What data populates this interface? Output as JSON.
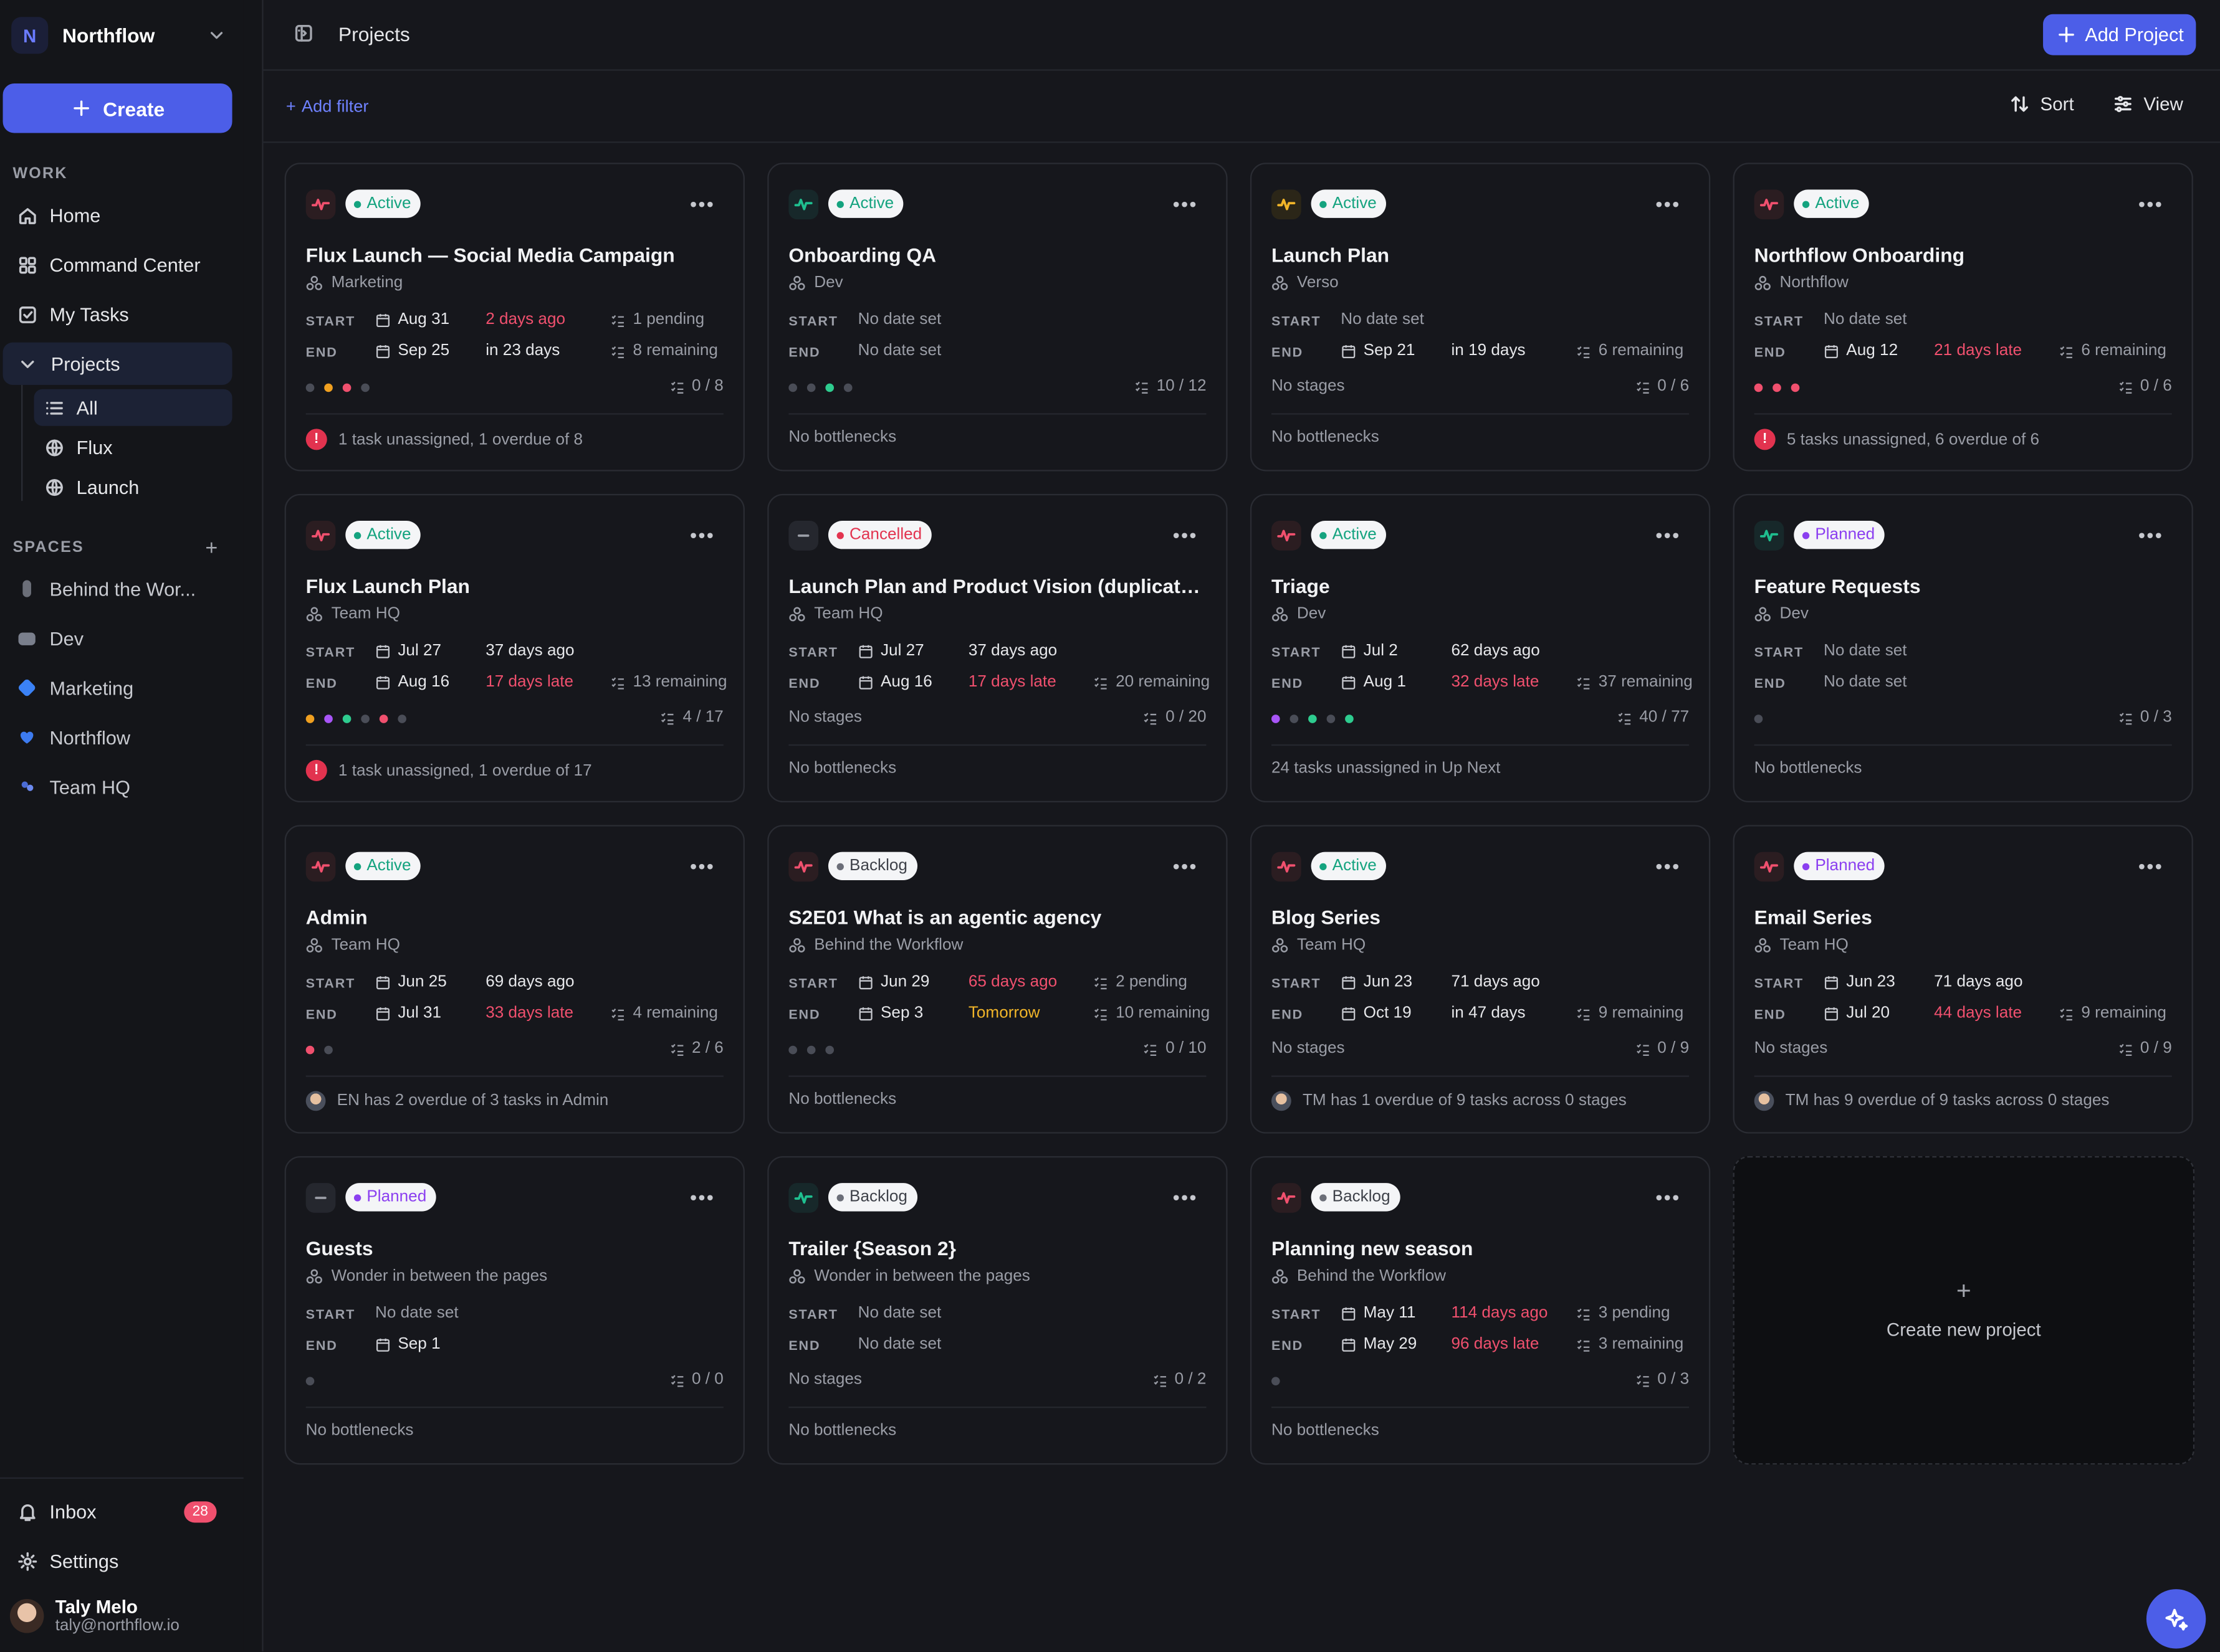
{
  "workspace": {
    "initial": "N",
    "name": "Northflow"
  },
  "sidebar": {
    "create_label": "Create",
    "work_label": "WORK",
    "items": [
      {
        "label": "Home"
      },
      {
        "label": "Command Center"
      },
      {
        "label": "My Tasks"
      },
      {
        "label": "Projects"
      }
    ],
    "project_views": [
      {
        "label": "All"
      },
      {
        "label": "Flux"
      },
      {
        "label": "Launch"
      }
    ],
    "spaces_label": "SPACES",
    "spaces": [
      {
        "label": "Behind the Wor...",
        "color": "#6b6e78"
      },
      {
        "label": "Dev",
        "color": "#7a7f8c"
      },
      {
        "label": "Marketing",
        "color": "#3b82f6"
      },
      {
        "label": "Northflow",
        "color": "#3d7bf0"
      },
      {
        "label": "Team HQ",
        "color": "#4b6cd6"
      }
    ],
    "inbox_label": "Inbox",
    "inbox_count": "28",
    "settings_label": "Settings",
    "user": {
      "name": "Taly Melo",
      "email": "taly@northflow.io"
    }
  },
  "header": {
    "title": "Projects",
    "add_project_label": "Add Project"
  },
  "toolbar": {
    "add_filter": "Add filter",
    "sort": "Sort",
    "view": "View"
  },
  "labels": {
    "start": "START",
    "end": "END",
    "no_date": "No date set",
    "no_stages": "No stages"
  },
  "create_new_label": "Create new project",
  "projects": [
    {
      "title": "Flux Launch — Social Media Campaign",
      "status": "Active",
      "space": "Marketing",
      "start": "Aug 31",
      "start_rel": "2 days ago",
      "start_meta": "1 pending",
      "end": "Sep 25",
      "end_rel": "in 23 days",
      "end_meta": "8 remaining",
      "progress": "0 / 8",
      "footer": "1 task unassigned, 1 overdue of 8"
    },
    {
      "title": "Onboarding QA",
      "status": "Active",
      "space": "Dev",
      "start": "",
      "start_rel": "",
      "start_meta": "",
      "end": "",
      "end_rel": "",
      "end_meta": "",
      "progress": "10 / 12",
      "footer": "No bottlenecks"
    },
    {
      "title": "Launch Plan",
      "status": "Active",
      "space": "Verso",
      "start": "",
      "start_rel": "",
      "start_meta": "",
      "end": "Sep 21",
      "end_rel": "in 19 days",
      "end_meta": "6 remaining",
      "progress": "0 / 6",
      "footer": "No bottlenecks"
    },
    {
      "title": "Northflow Onboarding",
      "status": "Active",
      "space": "Northflow",
      "start": "",
      "start_rel": "",
      "start_meta": "",
      "end": "Aug 12",
      "end_rel": "21 days late",
      "end_meta": "6 remaining",
      "progress": "0 / 6",
      "footer": "5 tasks unassigned, 6 overdue of 6"
    },
    {
      "title": "Flux Launch Plan",
      "status": "Active",
      "space": "Team HQ",
      "start": "Jul 27",
      "start_rel": "37 days ago",
      "start_meta": "",
      "end": "Aug 16",
      "end_rel": "17 days late",
      "end_meta": "13 remaining",
      "progress": "4 / 17",
      "footer": "1 task unassigned, 1 overdue of 17"
    },
    {
      "title": "Launch Plan and Product Vision (duplicate, ...",
      "status": "Cancelled",
      "space": "Team HQ",
      "start": "Jul 27",
      "start_rel": "37 days ago",
      "start_meta": "",
      "end": "Aug 16",
      "end_rel": "17 days late",
      "end_meta": "20 remaining",
      "progress": "0 / 20",
      "footer": "No bottlenecks"
    },
    {
      "title": "Triage",
      "status": "Active",
      "space": "Dev",
      "start": "Jul 2",
      "start_rel": "62 days ago",
      "start_meta": "",
      "end": "Aug 1",
      "end_rel": "32 days late",
      "end_meta": "37 remaining",
      "progress": "40 / 77",
      "footer": "24 tasks unassigned in Up Next"
    },
    {
      "title": "Feature Requests",
      "status": "Planned",
      "space": "Dev",
      "start": "",
      "start_rel": "",
      "start_meta": "",
      "end": "",
      "end_rel": "",
      "end_meta": "",
      "progress": "0 / 3",
      "footer": "No bottlenecks"
    },
    {
      "title": "Admin",
      "status": "Active",
      "space": "Team HQ",
      "start": "Jun 25",
      "start_rel": "69 days ago",
      "start_meta": "",
      "end": "Jul 31",
      "end_rel": "33 days late",
      "end_meta": "4 remaining",
      "progress": "2 / 6",
      "footer": "EN has 2 overdue of 3 tasks in Admin"
    },
    {
      "title": "S2E01 What is an agentic agency",
      "status": "Backlog",
      "space": "Behind the Workflow",
      "start": "Jun 29",
      "start_rel": "65 days ago",
      "start_meta": "2 pending",
      "end": "Sep 3",
      "end_rel": "Tomorrow",
      "end_meta": "10 remaining",
      "progress": "0 / 10",
      "footer": "No bottlenecks"
    },
    {
      "title": "Blog Series",
      "status": "Active",
      "space": "Team HQ",
      "start": "Jun 23",
      "start_rel": "71 days ago",
      "start_meta": "",
      "end": "Oct 19",
      "end_rel": "in 47 days",
      "end_meta": "9 remaining",
      "progress": "0 / 9",
      "footer": "TM has 1 overdue of 9 tasks across 0 stages"
    },
    {
      "title": "Email Series",
      "status": "Planned",
      "space": "Team HQ",
      "start": "Jun 23",
      "start_rel": "71 days ago",
      "start_meta": "",
      "end": "Jul 20",
      "end_rel": "44 days late",
      "end_meta": "9 remaining",
      "progress": "0 / 9",
      "footer": "TM has 9 overdue of 9 tasks across 0 stages"
    },
    {
      "title": "Guests",
      "status": "Planned",
      "space": "Wonder in between the pages",
      "start": "",
      "start_rel": "",
      "start_meta": "",
      "end": "Sep 1",
      "end_rel": "",
      "end_meta": "",
      "progress": "0 / 0",
      "footer": "No bottlenecks"
    },
    {
      "title": "Trailer {Season 2}",
      "status": "Backlog",
      "space": "Wonder in between the pages",
      "start": "",
      "start_rel": "",
      "start_meta": "",
      "end": "",
      "end_rel": "",
      "end_meta": "",
      "progress": "0 / 2",
      "footer": "No bottlenecks"
    },
    {
      "title": "Planning new season",
      "status": "Backlog",
      "space": "Behind the Workflow",
      "start": "May 11",
      "start_rel": "114 days ago",
      "start_meta": "3 pending",
      "end": "May 29",
      "end_rel": "96 days late",
      "end_meta": "3 remaining",
      "progress": "0 / 3",
      "footer": "No bottlenecks"
    }
  ],
  "colors": {
    "accent": "#4c5ee8",
    "late": "#f0506e",
    "tomorrow": "#f0b429",
    "active": "#14a37f",
    "planned": "#8b3ff0",
    "cancelled": "#e2334f",
    "backlog": "#6b6e78"
  }
}
